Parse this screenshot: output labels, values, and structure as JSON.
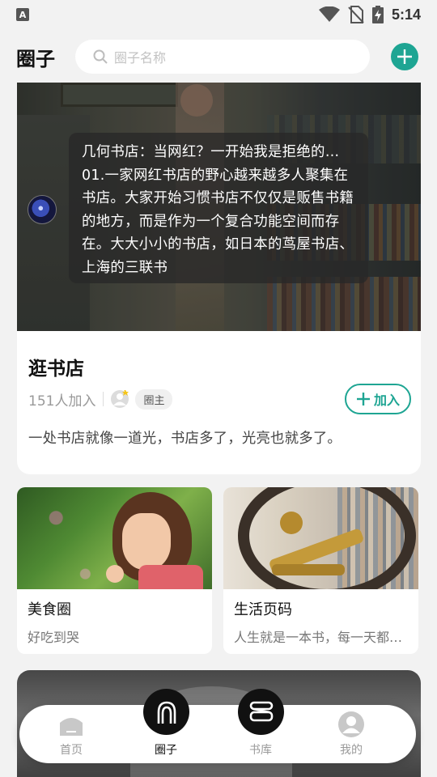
{
  "status_bar": {
    "time": "5:14",
    "notification_letter": "A"
  },
  "header": {
    "title": "圈子",
    "search_placeholder": "圈子名称"
  },
  "featured": {
    "excerpt": "几何书店：当网红？一开始我是拒绝的…01.一家网红书店的野心越来越多人聚集在书店。大家开始习惯书店不仅仅是贩售书籍的地方，而是作为一个复合功能空间而存在。大大小小的书店，如日本的茑屋书店、上海的三联书",
    "name": "逛书店",
    "members": "151人加入",
    "owner_badge": "圈主",
    "join_label": "加入",
    "description": "一处书店就像一道光，书店多了，光亮也就多了。"
  },
  "circles": [
    {
      "title": "美食圈",
      "subtitle": "好吃到哭"
    },
    {
      "title": "生活页码",
      "subtitle": "人生就是一本书，每一天都是一页"
    }
  ],
  "tabbar": {
    "tabs": [
      {
        "label": "首页"
      },
      {
        "label": "圈子"
      },
      {
        "label": "书库"
      },
      {
        "label": "我的"
      }
    ],
    "active": "圈子"
  },
  "colors": {
    "accent": "#1ea593",
    "background": "#f2f2f2"
  }
}
